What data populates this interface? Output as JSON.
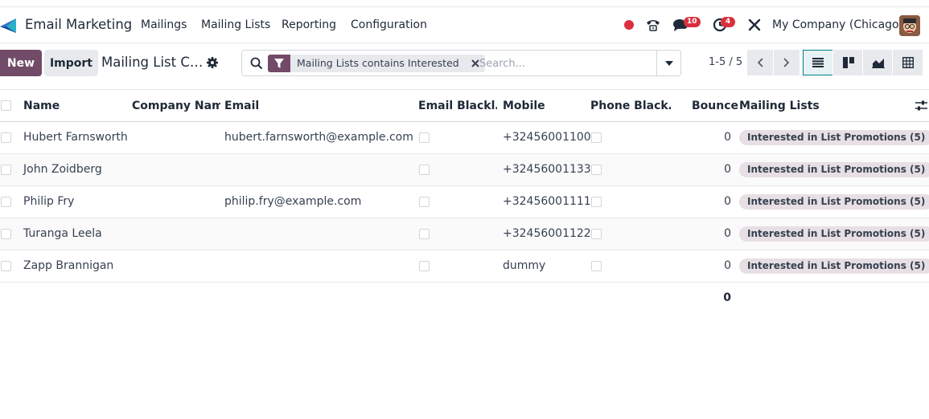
{
  "navbar": {
    "app_name": "Email Marketing",
    "menu": [
      "Mailings",
      "Mailing Lists",
      "Reporting",
      "Configuration"
    ],
    "chat_badge": "10",
    "activity_badge": "4",
    "company": "My Company (Chicago)",
    "icons": [
      "app-logo-icon",
      "recording-dot-icon",
      "phone-icon",
      "chat-icon",
      "activity-clock-icon",
      "debug-tools-icon",
      "avatar"
    ]
  },
  "control_panel": {
    "new_label": "New",
    "import_label": "Import",
    "breadcrumb": "Mailing List C…",
    "search": {
      "facet_label": "Mailing Lists contains Interested",
      "placeholder": "Search..."
    },
    "pager": "1-5 / 5"
  },
  "table": {
    "columns": [
      "Name",
      "Company Name",
      "Email",
      "Email Blackl…",
      "Mobile",
      "Phone Black…",
      "Bounce",
      "Mailing Lists"
    ],
    "rows": [
      {
        "name": "Hubert Farnsworth",
        "company": "",
        "email": "hubert.farnsworth@example.com",
        "mobile": "+32456001100",
        "bounce": "0",
        "lists": "Interested in List Promotions (5)"
      },
      {
        "name": "John Zoidberg",
        "company": "",
        "email": "",
        "mobile": "+32456001133",
        "bounce": "0",
        "lists": "Interested in List Promotions (5)"
      },
      {
        "name": "Philip Fry",
        "company": "",
        "email": "philip.fry@example.com",
        "mobile": "+32456001111",
        "bounce": "0",
        "lists": "Interested in List Promotions (5)"
      },
      {
        "name": "Turanga Leela",
        "company": "",
        "email": "",
        "mobile": "+32456001122",
        "bounce": "0",
        "lists": "Interested in List Promotions (5)"
      },
      {
        "name": "Zapp Brannigan",
        "company": "",
        "email": "",
        "mobile": "dummy",
        "bounce": "0",
        "lists": "Interested in List Promotions (5)"
      }
    ],
    "bounce_total": "0"
  },
  "colors": {
    "brand": "#714b67",
    "accent": "#017e84",
    "badge": "#d9303e",
    "tag_bg": "#e7dfe3"
  }
}
